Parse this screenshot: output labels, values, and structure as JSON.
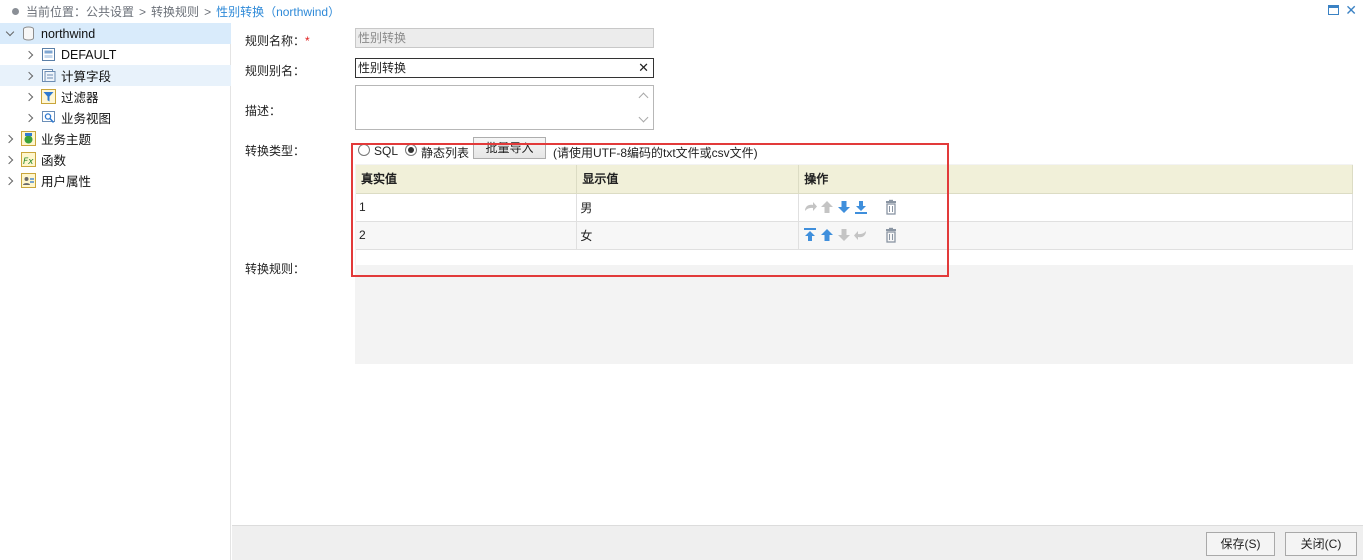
{
  "breadcrumb": {
    "prefix": "当前位置：",
    "items": [
      "公共设置",
      "转换规则"
    ],
    "current": "性别转换（northwind）",
    "separator": ">"
  },
  "tree": {
    "root": "northwind",
    "children": [
      "DEFAULT",
      "计算字段",
      "过滤器",
      "业务视图"
    ],
    "siblings": [
      "业务主题",
      "函数",
      "用户属性"
    ]
  },
  "form": {
    "name_label": "规则名称：",
    "name_required_mark": "*",
    "name_value": "性别转换",
    "alias_label": "规则别名：",
    "alias_value": "性别转换",
    "alias_clear": "✕",
    "desc_label": "描述：",
    "desc_value": "",
    "type_label": "转换类型：",
    "type_options": [
      "SQL",
      "静态列表"
    ],
    "type_selected": "静态列表",
    "import_button": "批量导入",
    "import_hint": "(请使用UTF-8编码的txt文件或csv文件)",
    "rule_label": "转换规则："
  },
  "table": {
    "headers": [
      "真实值",
      "显示值",
      "操作"
    ],
    "rows": [
      {
        "real": "1",
        "display": "男"
      },
      {
        "real": "2",
        "display": "女"
      }
    ]
  },
  "footer": {
    "save": "保存(S)",
    "close": "关闭(C)"
  },
  "colors": {
    "accent": "#2f8ad8",
    "highlight_box": "#e23a3a",
    "header_bg": "#f1f0d9",
    "selected_bg": "#d9ebfb"
  }
}
